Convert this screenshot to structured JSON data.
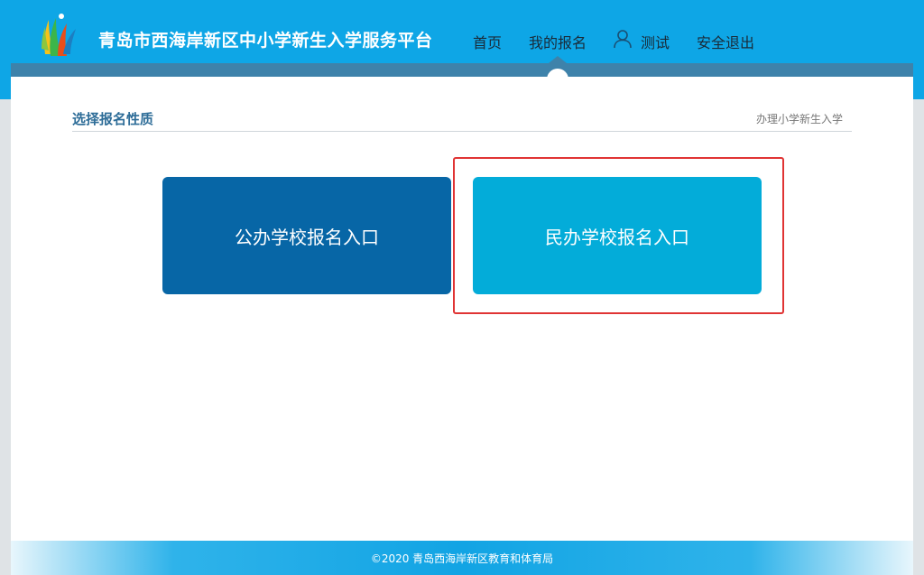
{
  "header": {
    "site_title": "青岛市西海岸新区中小学新生入学服务平台",
    "nav": {
      "home": "首页",
      "my_registration": "我的报名",
      "user": "测试",
      "logout": "安全退出"
    }
  },
  "section": {
    "title": "选择报名性质",
    "subtitle": "办理小学新生入学"
  },
  "cards": {
    "public": "公办学校报名入口",
    "private": "民办学校报名入口"
  },
  "footer": {
    "copyright": "©2020 青岛西海岸新区教育和体育局"
  },
  "colors": {
    "header_bg": "#0ea6e6",
    "subbar": "#3e82aa",
    "public_card": "#0766a6",
    "private_card": "#03acd9",
    "highlight": "#e03434",
    "section_title": "#2e6d98"
  },
  "icons": {
    "logo": "flame-logo",
    "user": "user-icon"
  }
}
